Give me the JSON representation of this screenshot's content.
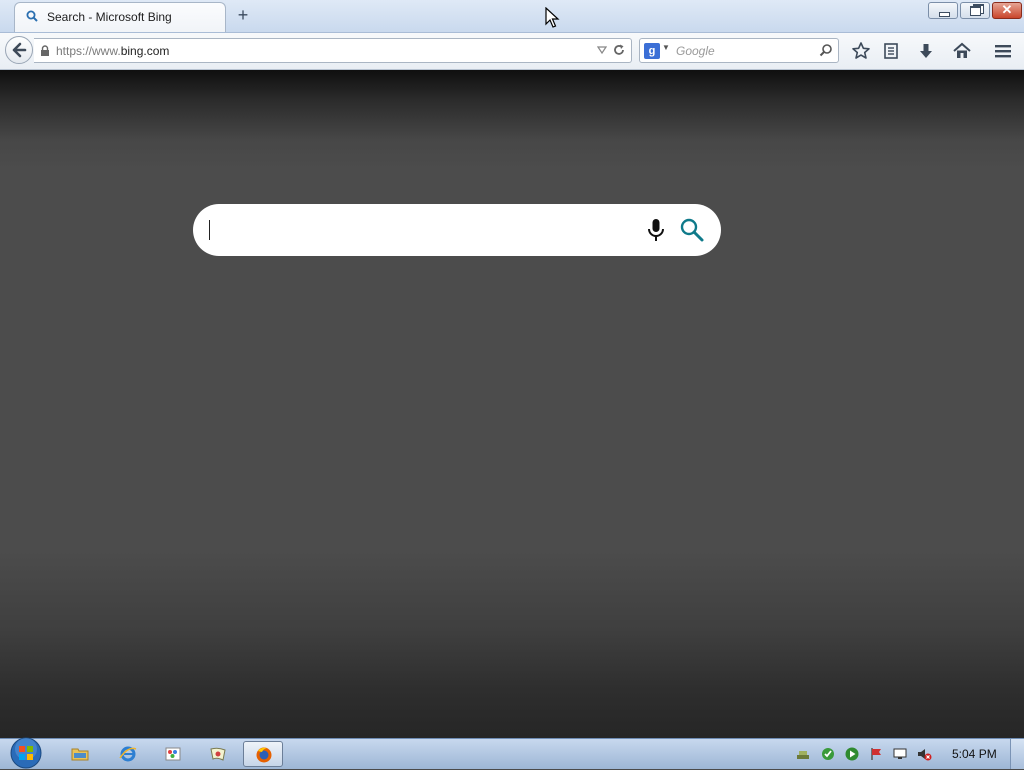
{
  "browser": {
    "tab": {
      "title": "Search - Microsoft Bing",
      "icon": "search-icon"
    },
    "new_tab_label": "+",
    "window_controls": {
      "minimize": "minimize-icon",
      "restore": "restore-icon",
      "close": "✕"
    },
    "url": {
      "scheme": "https://www.",
      "host": "bing.com"
    },
    "search_engine": {
      "letter": "g",
      "placeholder": "Google"
    },
    "toolbar_icons": [
      "bookmark-star-icon",
      "reader-list-icon",
      "download-icon",
      "home-icon",
      "menu-icon"
    ]
  },
  "page": {
    "search_value": "",
    "icons": [
      "microphone-icon",
      "search-icon"
    ]
  },
  "taskbar": {
    "clock": "5:04 PM",
    "pinned_apps": [
      "windows-explorer",
      "internet-explorer",
      "paint",
      "snipping-tool",
      "firefox"
    ],
    "tray_icons": [
      "network-icon",
      "security-icon",
      "media-icon",
      "flag-icon",
      "display-icon",
      "volume-muted-icon"
    ]
  },
  "colors": {
    "bing_accent": "#0f7a8a",
    "page_bg": "#4c4c4c",
    "taskbar": "#b2c8e4"
  }
}
